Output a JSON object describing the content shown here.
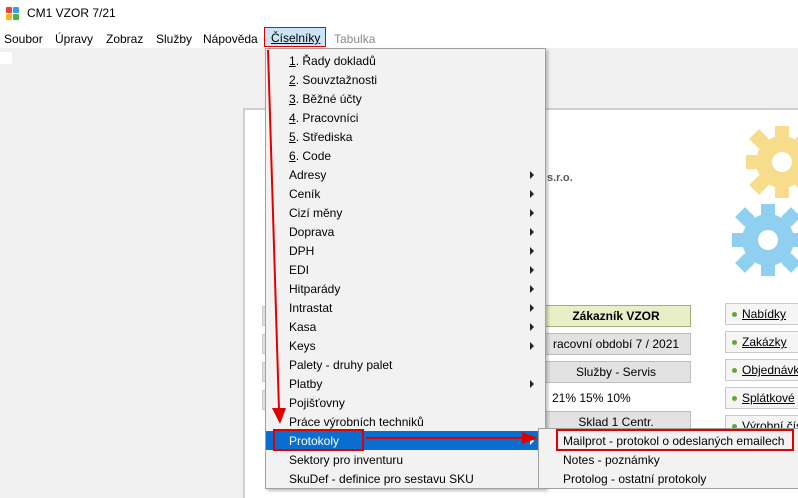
{
  "window": {
    "title": "CM1 VZOR 7/21"
  },
  "menubar": [
    {
      "label": "Soubor"
    },
    {
      "label": "Úpravy"
    },
    {
      "label": "Zobraz"
    },
    {
      "label": "Služby"
    },
    {
      "label": "Nápověda"
    },
    {
      "label": "Číselníky",
      "open": true
    },
    {
      "label": "Tabulka",
      "disabled": true
    }
  ],
  "dropdown": {
    "items": [
      {
        "acc": "1",
        "label": ". Řady dokladů"
      },
      {
        "acc": "2",
        "label": ". Souvztažnosti"
      },
      {
        "acc": "3",
        "label": ". Běžné účty"
      },
      {
        "acc": "4",
        "label": ". Pracovníci"
      },
      {
        "acc": "5",
        "label": ". Střediska"
      },
      {
        "acc": "6",
        "label": ". Code"
      },
      {
        "label": "Adresy",
        "submenu": true
      },
      {
        "label": "Ceník",
        "submenu": true
      },
      {
        "label": "Cizí měny",
        "submenu": true
      },
      {
        "label": "Doprava",
        "submenu": true
      },
      {
        "label": "DPH",
        "submenu": true
      },
      {
        "label": "EDI",
        "submenu": true
      },
      {
        "label": "Hitparády",
        "submenu": true
      },
      {
        "label": "Intrastat",
        "submenu": true
      },
      {
        "label": "Kasa",
        "submenu": true
      },
      {
        "label": "Keys",
        "submenu": true
      },
      {
        "label": "Palety - druhy palet"
      },
      {
        "label": "Platby",
        "submenu": true
      },
      {
        "label": "Pojišťovny"
      },
      {
        "label": "Práce výrobních techniků"
      },
      {
        "label": "Protokoly",
        "submenu": true,
        "selected": true
      },
      {
        "label": "Sektory pro inventuru"
      },
      {
        "label": "SkuDef - definice pro sestavu SKU"
      }
    ]
  },
  "submenu": {
    "items": [
      {
        "label": "Mailprot - protokol o odeslaných emailech"
      },
      {
        "label": "Notes - poznámky"
      },
      {
        "label": "Protolog - ostatní protokoly"
      }
    ]
  },
  "background": {
    "company_suffix": "s.r.o.",
    "center_buttons": [
      {
        "label": "Zákazník  VZOR",
        "highlight": true
      },
      {
        "label": "racovní období  7 / 2021"
      },
      {
        "label": "Služby - Servis"
      }
    ],
    "vat_rates": "21%  15%  10%",
    "warehouse": "Sklad 1 Centr.",
    "side_buttons": [
      {
        "label": "Nabídky"
      },
      {
        "label": "Zakázky"
      },
      {
        "label": "Objednávk"
      },
      {
        "label": "Splátkové"
      },
      {
        "label": "Výrobní čís"
      }
    ]
  },
  "colors": {
    "menu_selection": "#0a6ed1",
    "annotation_red": "#e00000",
    "open_menu_bg": "#cce4f7"
  },
  "icons": [
    "app-logo-icon",
    "submenu-arrow-icon",
    "gear-icon"
  ]
}
